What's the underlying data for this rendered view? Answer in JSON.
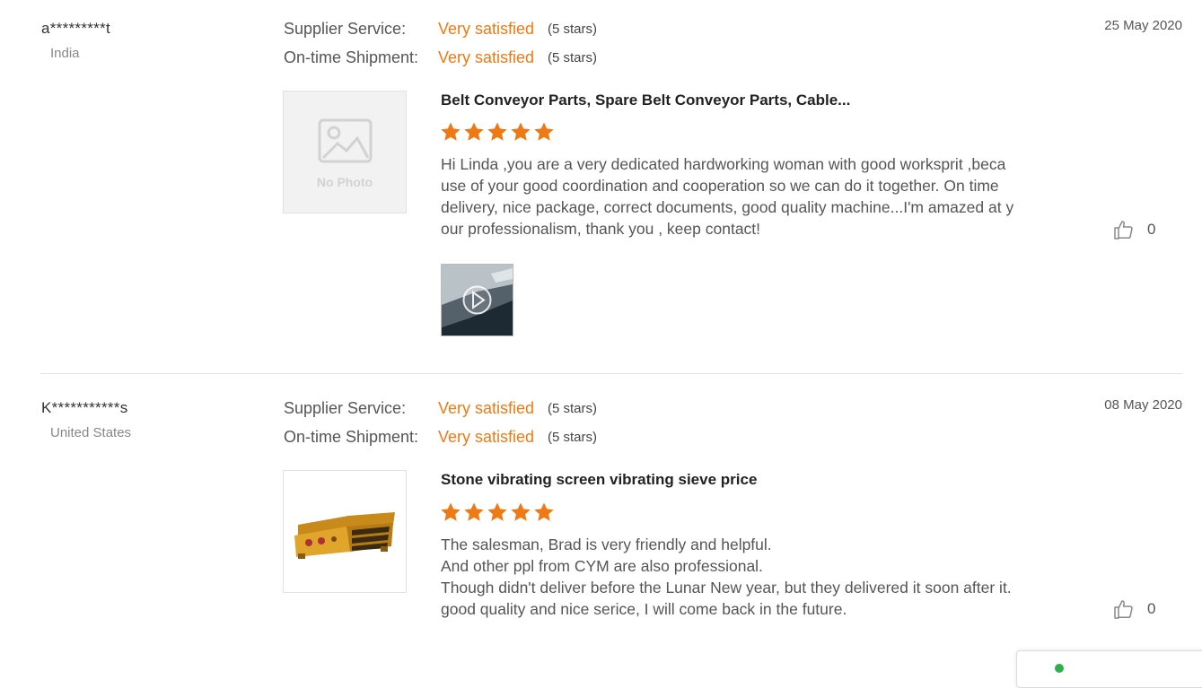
{
  "reviews": [
    {
      "name": "a*********t",
      "country": "India",
      "date": "25 May 2020",
      "supplier_service": {
        "label": "Supplier Service:",
        "value": "Very satisfied",
        "stars": "(5 stars)"
      },
      "ontime_shipment": {
        "label": "On-time Shipment:",
        "value": "Very satisfied",
        "stars": "(5 stars)"
      },
      "product_title": "Belt Conveyor Parts, Spare Belt Conveyor Parts, Cable...",
      "product_image": "No Photo",
      "rating": 5,
      "comment_lines": [
        "Hi Linda ,you are a very dedicated hardworking woman with good worksprit ,beca",
        "use of your good coordination and cooperation so we can do it together. On time",
        "delivery, nice package, correct documents, good quality machine...I'm amazed at y",
        "our professionalism, thank you , keep contact!"
      ],
      "likes": "0"
    },
    {
      "name": "K***********s",
      "country": "United States",
      "date": "08 May 2020",
      "supplier_service": {
        "label": "Supplier Service:",
        "value": "Very satisfied",
        "stars": "(5 stars)"
      },
      "ontime_shipment": {
        "label": "On-time Shipment:",
        "value": "Very satisfied",
        "stars": "(5 stars)"
      },
      "product_title": "Stone vibrating screen vibrating sieve price",
      "rating": 5,
      "comment_lines": [
        "The salesman, Brad is very friendly and helpful.",
        "And other ppl from CYM are also professional.",
        "Though didn't deliver before the Lunar New year, but they delivered it soon after it.",
        "good quality and nice serice, I will come back in the future."
      ],
      "likes": "0"
    }
  ],
  "colors": {
    "accent": "#ef7a14",
    "text": "#555555",
    "divider": "#e3e3e3"
  },
  "icons": {
    "star": "star-icon",
    "like": "thumbs-up-icon",
    "video": "play-icon",
    "no_photo": "image-placeholder-icon"
  }
}
